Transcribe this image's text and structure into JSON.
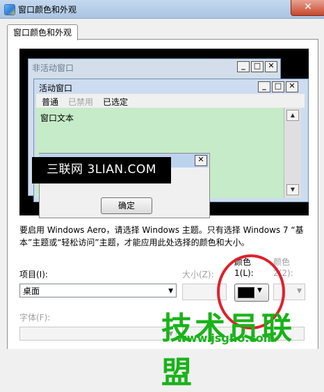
{
  "window": {
    "title": "窗口颜色和外观",
    "close_glyph": "✕"
  },
  "tabs": [
    {
      "label": "窗口颜色和外观"
    }
  ],
  "preview": {
    "inactive_title": "非活动窗口",
    "active_title": "活动窗口",
    "menu": [
      {
        "label": "普通",
        "state": "normal"
      },
      {
        "label": "已禁用",
        "state": "disabled"
      },
      {
        "label": "已选定",
        "state": "selected"
      }
    ],
    "window_text": "窗口文本",
    "watermark": "三联网 3LIAN.COM",
    "ok_button": "确定",
    "controls": {
      "min": "_",
      "max": "□",
      "close": "✕"
    }
  },
  "description": "要启用 Windows Aero，请选择 Windows 主题。只有选择 Windows 7 “基本”主题或“轻松访问”主题，才能应用此处选择的颜色和大小。",
  "form": {
    "item_label": "项目(I):",
    "item_value": "桌面",
    "size_label": "大小(Z):",
    "color1_label_line1": "颜色",
    "color1_label_line2": "1(L):",
    "color2_label_line1": "颜色",
    "color2_label_line2": "2(2):",
    "font_label": "字体(F):",
    "color1_value": "#000000"
  },
  "overlay": {
    "stamp": "技术员联盟",
    "url": "www.jsgho.com",
    "highlight_color": "#e0202b"
  }
}
